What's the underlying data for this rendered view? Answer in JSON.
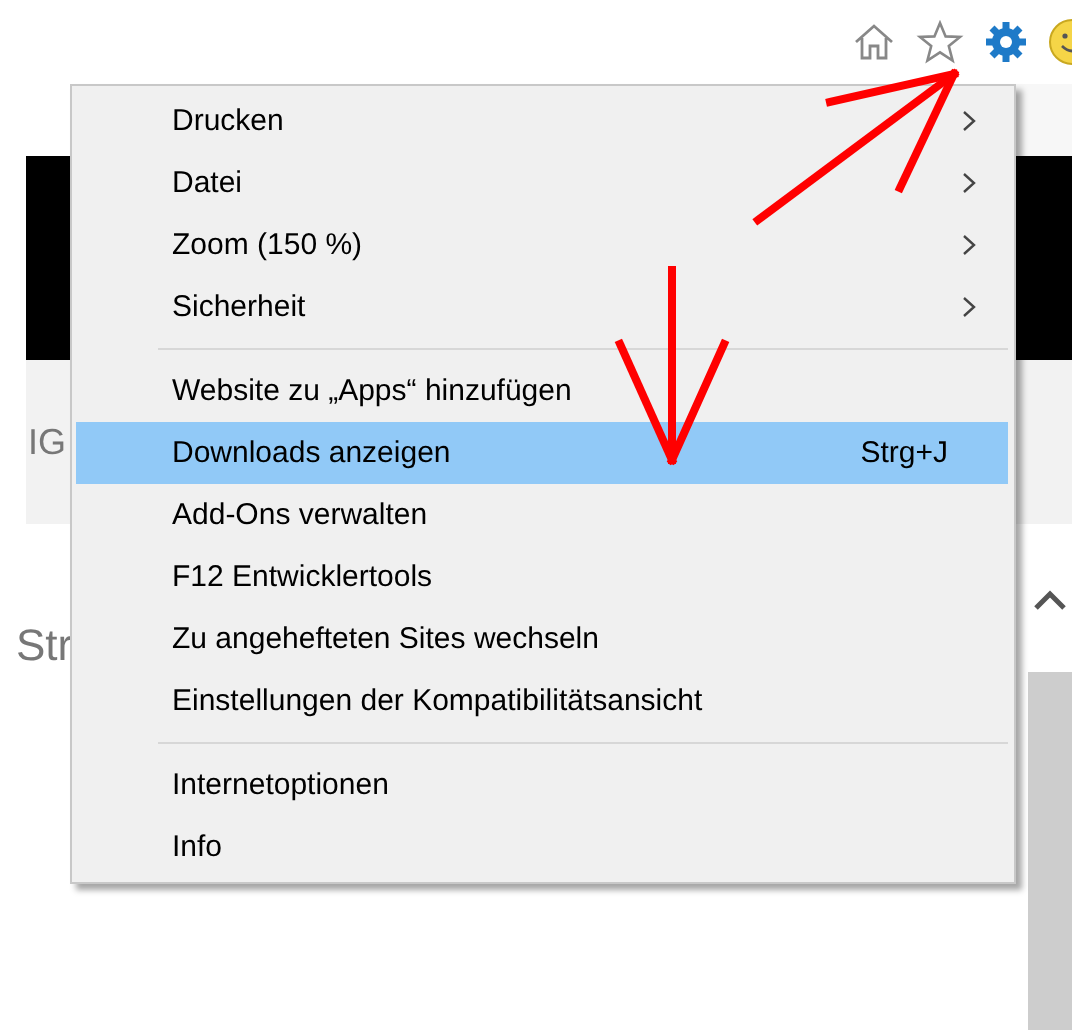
{
  "page": {
    "left_texts": [
      "IG",
      "Str"
    ]
  },
  "menu": {
    "groups": [
      [
        {
          "label": "Drucken",
          "submenu": true,
          "selected": false
        },
        {
          "label": "Datei",
          "submenu": true,
          "selected": false
        },
        {
          "label": "Zoom (150 %)",
          "submenu": true,
          "selected": false
        },
        {
          "label": "Sicherheit",
          "submenu": true,
          "selected": false
        }
      ],
      [
        {
          "label": "Website zu „Apps“ hinzufügen",
          "submenu": false,
          "selected": false
        },
        {
          "label": "Downloads anzeigen",
          "submenu": false,
          "selected": true,
          "shortcut": "Strg+J"
        },
        {
          "label": "Add-Ons verwalten",
          "submenu": false,
          "selected": false
        },
        {
          "label": "F12 Entwicklertools",
          "submenu": false,
          "selected": false
        },
        {
          "label": "Zu angehefteten Sites wechseln",
          "submenu": false,
          "selected": false
        },
        {
          "label": "Einstellungen der Kompatibilitätsansicht",
          "submenu": false,
          "selected": false
        }
      ],
      [
        {
          "label": "Internetoptionen",
          "submenu": false,
          "selected": false
        },
        {
          "label": "Info",
          "submenu": false,
          "selected": false
        }
      ]
    ]
  }
}
